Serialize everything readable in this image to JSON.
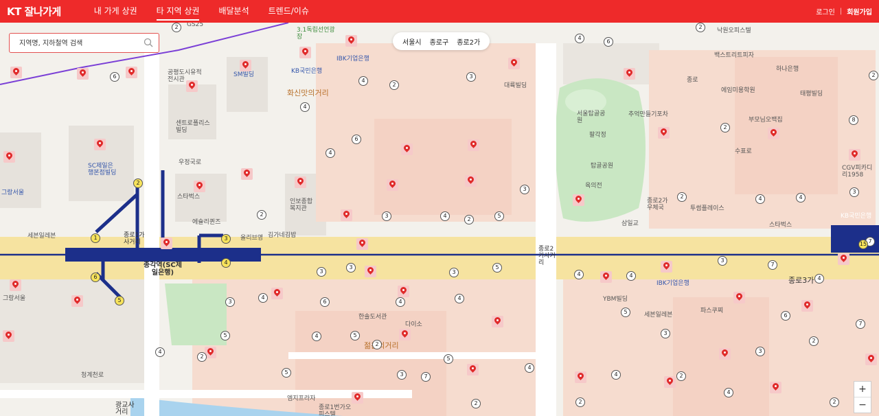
{
  "header": {
    "logo": "KT 잘나가게",
    "tabs": [
      {
        "label": "내 가게 상권",
        "active": false
      },
      {
        "label": "타 지역 상권",
        "active": true
      },
      {
        "label": "배달분석",
        "active": false
      },
      {
        "label": "트렌드/이슈",
        "active": false
      }
    ],
    "login_label": "로그인",
    "separator": "|",
    "signup_label": "회원가입"
  },
  "search": {
    "placeholder": "지역명, 지하철역 검색",
    "icon": "search-icon"
  },
  "breadcrumb": [
    "서울시",
    "종로구",
    "종로2가"
  ],
  "zoom": {
    "in_label": "+",
    "out_label": "−"
  },
  "colors": {
    "brand": "#ee2a2a",
    "pin": "#e02a2a",
    "line1": "#1c2f8a",
    "road": "#f6e3a0",
    "park": "#c9e7c3"
  },
  "map_labels": {
    "l1": "GS25",
    "l2": "3.1독립선언광장",
    "l3": "IBK기업은행",
    "l4": "KB국민은행",
    "l5": "SM빌딩",
    "l6": "공평도시유적전시관",
    "l7": "화신맛의거리",
    "l8": "센트로폴리스빌딩",
    "l9": "SC제일은행본점빌딩",
    "l10": "그랑서울",
    "l11": "세븐일레븐",
    "l12": "종로1가사거리",
    "l13": "종각역(SC제일은행)",
    "l14": "올리브영",
    "l15": "김가네김밥",
    "l16": "인보종합복지관",
    "l17": "에슐리퀸즈",
    "l18": "스타벅스",
    "l19": "서울탑골공원",
    "l20": "팔각정",
    "l21": "탑골공원",
    "l22": "육의전",
    "l23": "종로2가사거리",
    "l24": "IBK기업은행",
    "l25": "YBM빌딩",
    "l26": "종로3가",
    "l27": "CGV피카디리1958",
    "l28": "종로2가우체국",
    "l29": "투썸플레이스",
    "l30": "삼일교",
    "l31": "청계천로",
    "l32": "광교사거리",
    "l33": "젊음의거리",
    "l34": "종로1번가오피스텔",
    "l35": "대륙빌딩",
    "l36": "엠지프라자",
    "l37": "한솔도서관",
    "l38": "우정국로",
    "l39": "파스쿠찌",
    "l40": "다이소",
    "l41": "세븐일레븐",
    "l42": "태평빌딩",
    "l43": "그랑서울",
    "l44": "수표로",
    "l45": "KB국민은행",
    "l46": "스타벅스",
    "l47": "낙원오피스텔",
    "l48": "백스트리트피자",
    "l49": "에임미용학원",
    "l50": "추억만들기포차",
    "l51": "부모님오백집",
    "l52": "하나은행",
    "l53": "종로"
  }
}
